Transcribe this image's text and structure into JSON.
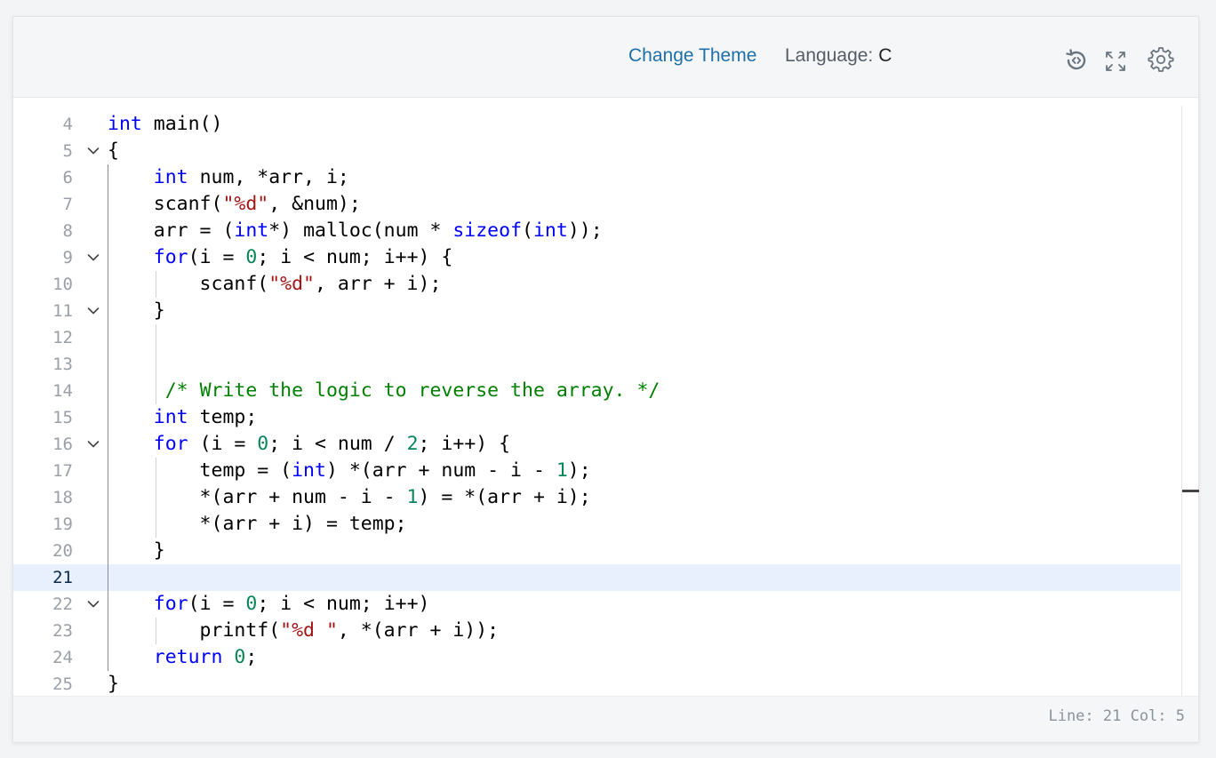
{
  "toolbar": {
    "change_theme_label": "Change Theme",
    "language_label": "Language:",
    "language_value": "C",
    "icons": [
      "reset-icon",
      "fullscreen-icon",
      "settings-icon"
    ]
  },
  "colors": {
    "keyword": "#0000ff",
    "string": "#a31515",
    "number": "#098658",
    "comment": "#008000",
    "link": "#1f6fa8",
    "active_line": "#e8f0fd"
  },
  "editor": {
    "active_line": 21,
    "lines": [
      {
        "n": "4",
        "fold": false,
        "html": "<span class=\"kw\">int</span> main()"
      },
      {
        "n": "5",
        "fold": true,
        "html": "{"
      },
      {
        "n": "6",
        "fold": false,
        "html": "    <span class=\"kw\">int</span> num, *arr, i;"
      },
      {
        "n": "7",
        "fold": false,
        "html": "    scanf(<span class=\"str\">\"%d\"</span>, &amp;num);"
      },
      {
        "n": "8",
        "fold": false,
        "html": "    arr = (<span class=\"kw\">int</span>*) malloc(num * <span class=\"kw\">sizeof</span>(<span class=\"kw\">int</span>));"
      },
      {
        "n": "9",
        "fold": true,
        "html": "    <span class=\"kw\">for</span>(i = <span class=\"num\">0</span>; i &lt; num; i++) {"
      },
      {
        "n": "10",
        "fold": false,
        "html": "        scanf(<span class=\"str\">\"%d\"</span>, arr + i);"
      },
      {
        "n": "11",
        "fold": true,
        "html": "    }"
      },
      {
        "n": "12",
        "fold": false,
        "html": ""
      },
      {
        "n": "13",
        "fold": false,
        "html": ""
      },
      {
        "n": "14",
        "fold": false,
        "html": "     <span class=\"cm\">/* Write the logic to reverse the array. */</span>"
      },
      {
        "n": "15",
        "fold": false,
        "html": "    <span class=\"kw\">int</span> temp;"
      },
      {
        "n": "16",
        "fold": true,
        "html": "    <span class=\"kw\">for</span> (i = <span class=\"num\">0</span>; i &lt; num / <span class=\"num\">2</span>; i++) {"
      },
      {
        "n": "17",
        "fold": false,
        "html": "        temp = (<span class=\"kw\">int</span>) *(arr + num - i - <span class=\"num\">1</span>);"
      },
      {
        "n": "18",
        "fold": false,
        "html": "        *(arr + num - i - <span class=\"num\">1</span>) = *(arr + i);"
      },
      {
        "n": "19",
        "fold": false,
        "html": "        *(arr + i) = temp;"
      },
      {
        "n": "20",
        "fold": false,
        "html": "    }"
      },
      {
        "n": "21",
        "fold": false,
        "html": ""
      },
      {
        "n": "22",
        "fold": true,
        "html": "    <span class=\"kw\">for</span>(i = <span class=\"num\">0</span>; i &lt; num; i++)"
      },
      {
        "n": "23",
        "fold": false,
        "html": "        printf(<span class=\"str\">\"%d \"</span>, *(arr + i));"
      },
      {
        "n": "24",
        "fold": false,
        "html": "    <span class=\"kw\">return</span> <span class=\"num\">0</span>;"
      },
      {
        "n": "25",
        "fold": false,
        "html": "}"
      }
    ]
  },
  "status": {
    "text": "Line: 21 Col: 5"
  }
}
